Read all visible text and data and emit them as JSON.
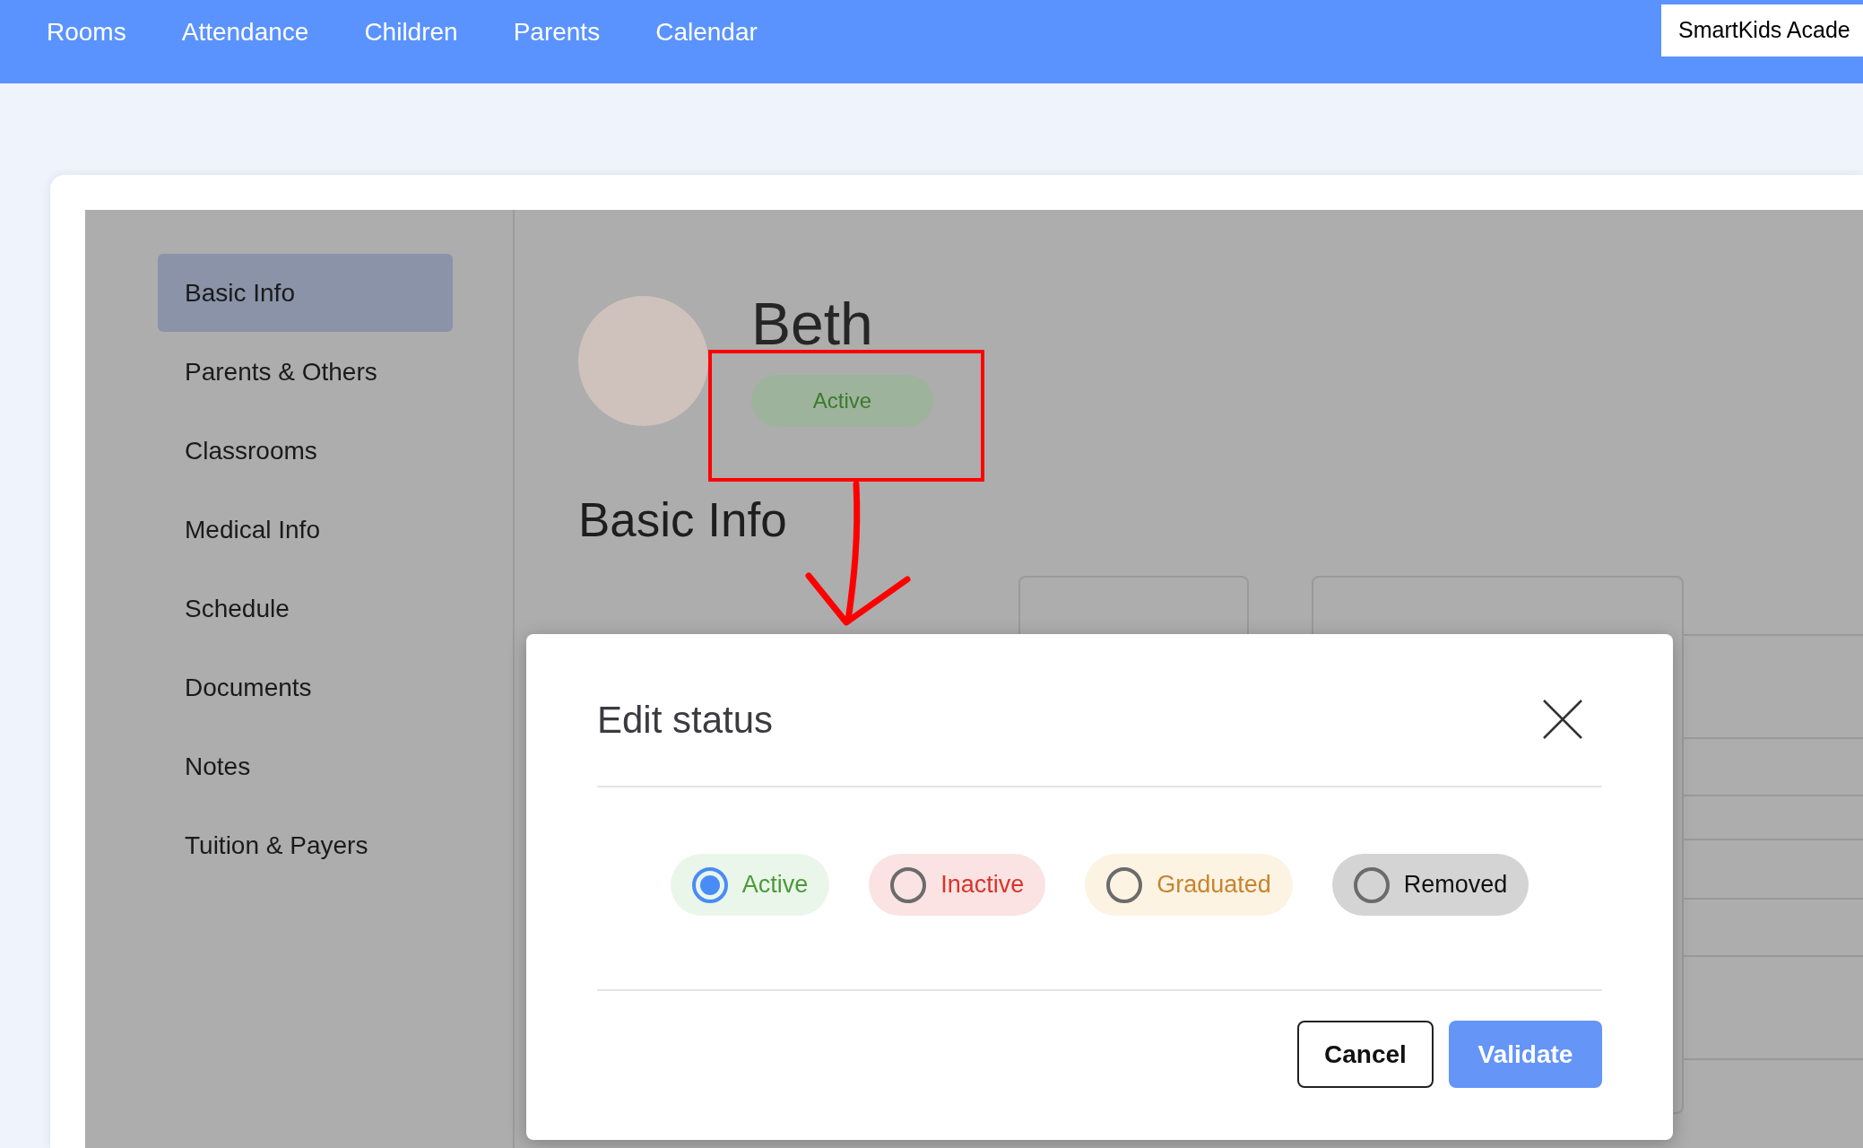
{
  "nav": {
    "items": [
      {
        "label": "Rooms"
      },
      {
        "label": "Attendance"
      },
      {
        "label": "Children"
      },
      {
        "label": "Parents"
      },
      {
        "label": "Calendar"
      }
    ],
    "school": "SmartKids Acade"
  },
  "sidebar": {
    "items": [
      {
        "label": "Basic Info",
        "selected": true
      },
      {
        "label": "Parents & Others",
        "selected": false
      },
      {
        "label": "Classrooms",
        "selected": false
      },
      {
        "label": "Medical Info",
        "selected": false
      },
      {
        "label": "Schedule",
        "selected": false
      },
      {
        "label": "Documents",
        "selected": false
      },
      {
        "label": "Notes",
        "selected": false
      },
      {
        "label": "Tuition & Payers",
        "selected": false
      }
    ]
  },
  "child": {
    "name": "Beth",
    "status": "Active"
  },
  "section_title": "Basic Info",
  "dialog": {
    "title": "Edit status",
    "options": [
      {
        "label": "Active",
        "kind": "active",
        "selected": true
      },
      {
        "label": "Inactive",
        "kind": "inactive",
        "selected": false
      },
      {
        "label": "Graduated",
        "kind": "graduated",
        "selected": false
      },
      {
        "label": "Removed",
        "kind": "removed",
        "selected": false
      }
    ],
    "buttons": [
      {
        "label": "Cancel",
        "kind": "secondary"
      },
      {
        "label": "Validate",
        "kind": "primary"
      }
    ]
  }
}
